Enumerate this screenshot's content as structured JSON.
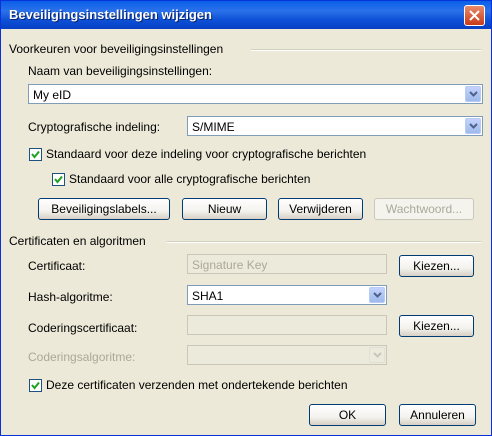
{
  "window": {
    "title": "Beveiligingsinstellingen wijzigen"
  },
  "prefs": {
    "group_title": "Voorkeuren voor beveiligingsinstellingen",
    "name_label": "Naam van beveiligingsinstellingen:",
    "name_value": "My eID",
    "crypto_label": "Cryptografische indeling:",
    "crypto_value": "S/MIME",
    "default_format_label": "Standaard voor deze indeling voor cryptografische berichten",
    "default_all_label": "Standaard voor alle cryptografische berichten",
    "buttons": {
      "labels": "Beveiligingslabels...",
      "new": "Nieuw",
      "delete": "Verwijderen",
      "password": "Wachtwoord..."
    }
  },
  "certs": {
    "group_title": "Certificaten en algoritmen",
    "cert_label": "Certificaat:",
    "cert_value": "Signature Key",
    "choose1": "Kiezen...",
    "hash_label": "Hash-algoritme:",
    "hash_value": "SHA1",
    "enc_cert_label": "Coderingscertificaat:",
    "enc_cert_value": "",
    "choose2": "Kiezen...",
    "enc_alg_label": "Coderingsalgoritme:",
    "enc_alg_value": "",
    "send_certs_label": "Deze certificaten verzenden met ondertekende berichten"
  },
  "footer": {
    "ok": "OK",
    "cancel": "Annuleren"
  },
  "colors": {
    "titlebar": "#0a5fe8",
    "dialog_bg": "#ece9d8",
    "close_button": "#c63b18",
    "check_mark": "#21a121"
  },
  "icons": [
    "close-icon",
    "chevron-down-icon",
    "checkmark-icon"
  ]
}
